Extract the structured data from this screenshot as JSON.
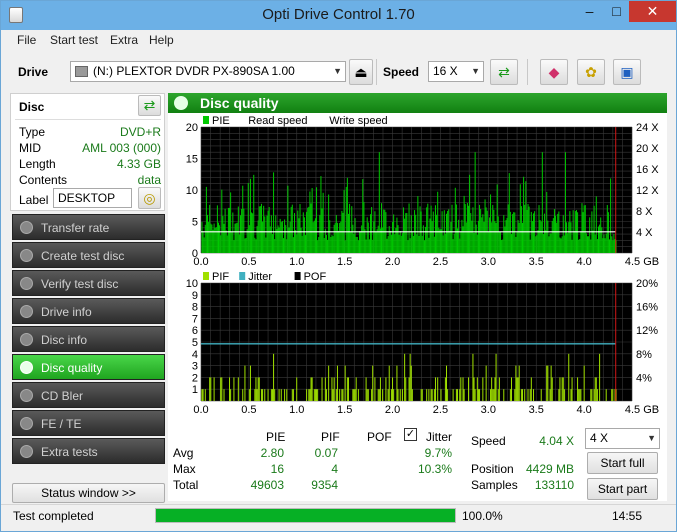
{
  "window": {
    "title": "Opti Drive Control 1.70",
    "minimize": "–",
    "maximize": "□",
    "close": "✕"
  },
  "menu": [
    "File",
    "Start test",
    "Extra",
    "Help"
  ],
  "toolbar": {
    "drive_label": "Drive",
    "drive_value": "(N:)  PLEXTOR DVDR   PX-890SA 1.00",
    "speed_label": "Speed",
    "speed_value": "16 X"
  },
  "disc": {
    "title": "Disc",
    "rows": [
      {
        "k": "Type",
        "v": "DVD+R"
      },
      {
        "k": "MID",
        "v": "AML 003 (000)"
      },
      {
        "k": "Length",
        "v": "4.33 GB"
      },
      {
        "k": "Contents",
        "v": "data"
      }
    ],
    "label_key": "Label",
    "label_value": "DESKTOP"
  },
  "nav": [
    "Transfer rate",
    "Create test disc",
    "Verify test disc",
    "Drive info",
    "Disc info",
    "Disc quality",
    "CD Bler",
    "FE / TE",
    "Extra tests"
  ],
  "nav_active": "Disc quality",
  "status_window_btn": "Status window >>",
  "panel_title": "Disc quality",
  "chart_data": [
    {
      "type": "bar",
      "legend": [
        "PIE",
        "Read speed",
        "Write speed"
      ],
      "legend_colors": [
        "#00c800",
        "#ffffff",
        "#ffffff"
      ],
      "x_ticks": [
        "0.0",
        "0.5",
        "1.0",
        "1.5",
        "2.0",
        "2.5",
        "3.0",
        "3.5",
        "4.0",
        "4.5 GB"
      ],
      "y_ticks_left": [
        "20",
        "15",
        "10",
        "5",
        "0"
      ],
      "y_ticks_right": [
        "24 X",
        "20 X",
        "16 X",
        "12 X",
        "8 X",
        "4 X"
      ],
      "xlim": [
        0,
        4.5
      ],
      "ylim": [
        0,
        20
      ],
      "y2lim": [
        0,
        24
      ],
      "read_speed_x": 4.04,
      "end_marker_x": 4.33,
      "values_summary": {
        "avg": 2.8,
        "max": 16,
        "range_typical": [
          2,
          10
        ]
      }
    },
    {
      "type": "bar",
      "legend": [
        "PIF",
        "Jitter",
        "POF"
      ],
      "legend_colors": [
        "#a0e000",
        "#40b0c0",
        "#000000"
      ],
      "x_ticks": [
        "0.0",
        "0.5",
        "1.0",
        "1.5",
        "2.0",
        "2.5",
        "3.0",
        "3.5",
        "4.0",
        "4.5 GB"
      ],
      "y_ticks_left": [
        "10",
        "9",
        "8",
        "7",
        "6",
        "5",
        "4",
        "3",
        "2",
        "1"
      ],
      "y_ticks_right": [
        "20%",
        "16%",
        "12%",
        "8%",
        "4%"
      ],
      "xlim": [
        0,
        4.5
      ],
      "ylim": [
        0,
        10
      ],
      "y2lim": [
        0,
        20
      ],
      "jitter_pct": 9.7,
      "end_marker_x": 4.33,
      "values_summary": {
        "avg": 0.07,
        "max": 4
      }
    }
  ],
  "stats": {
    "headers": [
      "PIE",
      "PIF",
      "POF",
      "Jitter"
    ],
    "jitter_checked": "✓",
    "rows": [
      {
        "k": "Avg",
        "pie": "2.80",
        "pif": "0.07",
        "jit": "9.7%"
      },
      {
        "k": "Max",
        "pie": "16",
        "pif": "4",
        "jit": "10.3%"
      },
      {
        "k": "Total",
        "pie": "49603",
        "pif": "9354",
        "jit": ""
      }
    ],
    "speed_label": "Speed",
    "speed_value": "4.04 X",
    "speed_select": "4 X",
    "position_label": "Position",
    "position_value": "4429 MB",
    "samples_label": "Samples",
    "samples_value": "133110",
    "start_full": "Start full",
    "start_part": "Start part"
  },
  "status": {
    "text": "Test completed",
    "progress": "100.0%",
    "progress_value": 1.0,
    "time": "14:55"
  }
}
